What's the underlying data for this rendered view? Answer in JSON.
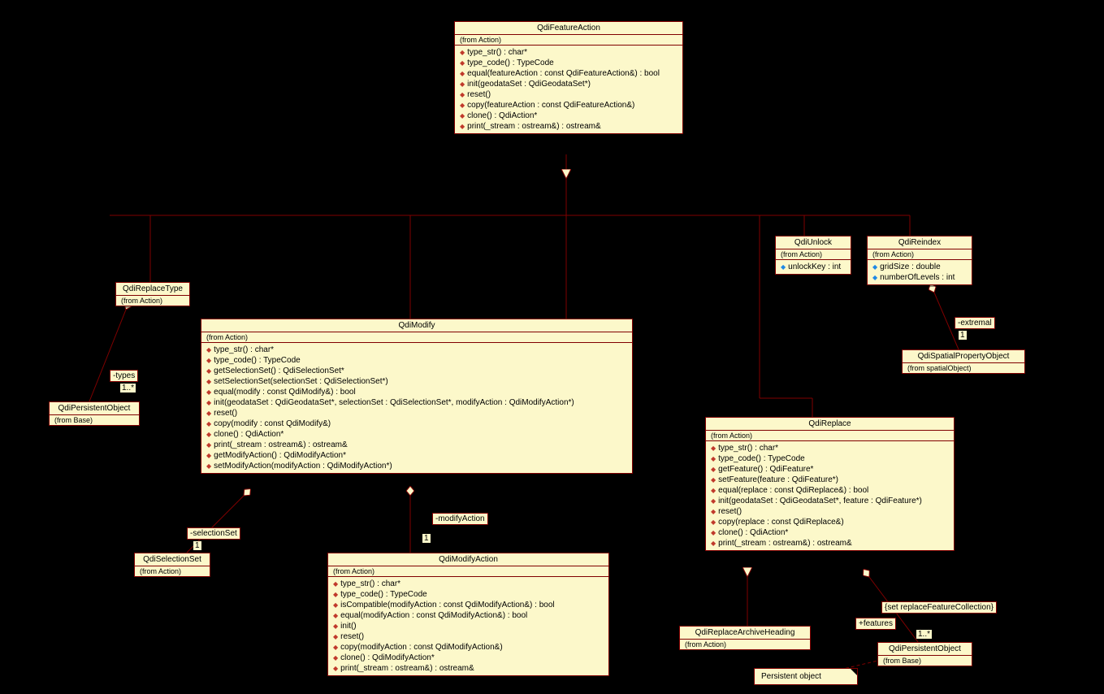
{
  "classes": {
    "featureAction": {
      "name": "QdiFeatureAction",
      "from": "(from Action)",
      "ops": [
        "type_str() : char*",
        "type_code() : TypeCode",
        "equal(featureAction : const QdiFeatureAction&) : bool",
        "init(geodataSet : QdiGeodataSet*)",
        "reset()",
        "copy(featureAction : const QdiFeatureAction&)",
        "clone() : QdiAction*",
        "print(_stream : ostream&) : ostream&"
      ]
    },
    "replaceType": {
      "name": "QdiReplaceType",
      "from": "(from Action)"
    },
    "persistentObject1": {
      "name": "QdiPersistentObject",
      "from": "(from Base)"
    },
    "modify": {
      "name": "QdiModify",
      "from": "(from Action)",
      "ops": [
        "type_str() : char*",
        "type_code() : TypeCode",
        "getSelectionSet() : QdiSelectionSet*",
        "setSelectionSet(selectionSet : QdiSelectionSet*)",
        "equal(modify : const QdiModify&) : bool",
        "init(geodataSet : QdiGeodataSet*, selectionSet : QdiSelectionSet*, modifyAction : QdiModifyAction*)",
        "reset()",
        "copy(modify : const QdiModify&)",
        "clone() : QdiAction*",
        "print(_stream : ostream&) : ostream&",
        "getModifyAction() : QdiModifyAction*",
        "setModifyAction(modifyAction : QdiModifyAction*)"
      ]
    },
    "selectionSet": {
      "name": "QdiSelectionSet",
      "from": "(from Action)"
    },
    "modifyAction": {
      "name": "QdiModifyAction",
      "from": "(from Action)",
      "ops": [
        "type_str() : char*",
        "type_code() : TypeCode",
        "isCompatible(modifyAction : const QdiModifyAction&) : bool",
        "equal(modifyAction : const QdiModifyAction&) : bool",
        "init()",
        "reset()",
        "copy(modifyAction : const QdiModifyAction&)",
        "clone() : QdiModifyAction*",
        "print(_stream : ostream&) : ostream&"
      ]
    },
    "unlock": {
      "name": "QdiUnlock",
      "from": "(from Action)",
      "attrs": [
        "unlockKey : int"
      ]
    },
    "reindex": {
      "name": "QdiReindex",
      "from": "(from Action)",
      "attrs": [
        "gridSize : double",
        "numberOfLevels : int"
      ]
    },
    "spatialProp": {
      "name": "QdiSpatialPropertyObject",
      "from": "(from spatialObject)"
    },
    "replace": {
      "name": "QdiReplace",
      "from": "(from Action)",
      "ops": [
        "type_str() : char*",
        "type_code() : TypeCode",
        "getFeature() : QdiFeature*",
        "setFeature(feature : QdiFeature*)",
        "equal(replace : const QdiReplace&) : bool",
        "init(geodataSet : QdiGeodataSet*, feature : QdiFeature*)",
        "reset()",
        "copy(replace : const QdiReplace&)",
        "clone() : QdiAction*",
        "print(_stream : ostream&) : ostream&"
      ]
    },
    "replaceArchive": {
      "name": "QdiReplaceArchiveHeading",
      "from": "(from Action)"
    },
    "persistentObject2": {
      "name": "QdiPersistentObject",
      "from": "(from Base)"
    }
  },
  "labels": {
    "types": "-types",
    "typesMult": "1..*",
    "selectionSet": "-selectionSet",
    "selSetMult": "1",
    "modifyAction": "-modifyAction",
    "modActMult": "1",
    "extremal": "-extremal",
    "extremalMult": "1",
    "features": "+features",
    "featuresMult": "1..*",
    "featuresSet": "{set replaceFeatureCollection}"
  },
  "note": "Persistent object"
}
